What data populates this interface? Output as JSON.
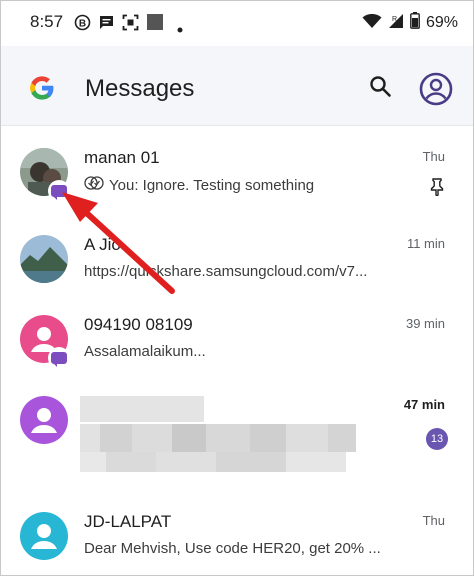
{
  "status_bar": {
    "time": "8:57",
    "battery": "69%",
    "icons": [
      "b-circle-icon",
      "message-icon",
      "screenshot-icon",
      "square-icon",
      "dot-icon",
      "wifi-icon",
      "signal-icon",
      "battery-icon"
    ]
  },
  "app_bar": {
    "title": "Messages",
    "logo": "google-g-icon",
    "search_icon": "search-icon",
    "account_icon": "account-circle-icon"
  },
  "conversations": [
    {
      "name": "manan 01",
      "preview": "You: Ignore. Testing something",
      "time": "Thu",
      "pinned": true,
      "read_receipt": "double-check-icon",
      "avatar": "photo",
      "chat_badge": true
    },
    {
      "name": "A Jio",
      "preview": "https://quickshare.samsungcloud.com/v7...",
      "time": "11 min",
      "avatar": "landscape-photo"
    },
    {
      "name": "094190 08109",
      "preview": "Assalamalaikum...",
      "time": "39 min",
      "avatar": "person",
      "avatar_color": "#e84c8a",
      "chat_badge": true
    },
    {
      "name": "",
      "preview": "",
      "time": "47 min",
      "unread": "13",
      "avatar": "person",
      "avatar_color": "#a855dc",
      "blurred": true
    },
    {
      "name": "JD-LALPAT",
      "preview": "Dear Mehvish, Use code HER20, get 20% ...",
      "time": "Thu",
      "avatar": "person",
      "avatar_color": "#27b6d4"
    }
  ],
  "colors": {
    "accent": "#6a55b0",
    "app_bar_bg": "#f4f6fa",
    "arrow": "#e0201f"
  }
}
